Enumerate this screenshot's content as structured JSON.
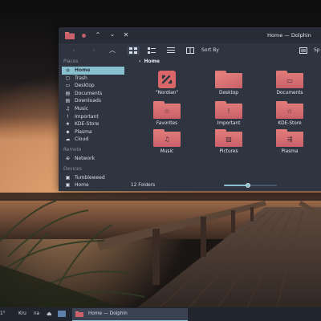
{
  "window": {
    "title": "Home — Dolphin",
    "titlebar_buttons": [
      "chevron-up",
      "chevron-down",
      "close"
    ]
  },
  "toolbar": {
    "back_icon": "arrow-left-icon",
    "forward_icon": "arrow-right-icon",
    "up_icon": "arrow-up-icon",
    "sort_label": "Sort By",
    "search_label": "Sp"
  },
  "sidebar": {
    "places_heading": "Places",
    "places": [
      {
        "label": "Home",
        "icon": "home-icon",
        "active": true
      },
      {
        "label": "Trash",
        "icon": "trash-icon"
      },
      {
        "label": "Desktop",
        "icon": "desktop-icon"
      },
      {
        "label": "Documents",
        "icon": "documents-icon"
      },
      {
        "label": "Downloads",
        "icon": "downloads-icon"
      },
      {
        "label": "Music",
        "icon": "music-icon"
      },
      {
        "label": "Important",
        "icon": "important-icon"
      },
      {
        "label": "KDE-Store",
        "icon": "kde-store-icon"
      },
      {
        "label": "Plasma",
        "icon": "plasma-icon"
      },
      {
        "label": "Cloud",
        "icon": "cloud-icon"
      }
    ],
    "remote_heading": "Remote",
    "remote": [
      {
        "label": "Network",
        "icon": "network-icon"
      }
    ],
    "devices_heading": "Devices",
    "devices": [
      {
        "label": "Tumbleweed",
        "icon": "drive-icon"
      },
      {
        "label": "Home",
        "icon": "drive-icon"
      }
    ]
  },
  "breadcrumb": {
    "current": "Home"
  },
  "folders": [
    {
      "label": "\"Nordian\"",
      "glyph": "",
      "kind": "logo"
    },
    {
      "label": "Desktop",
      "glyph": "",
      "kind": "folder"
    },
    {
      "label": "Documents",
      "glyph": "▭",
      "kind": "folder"
    },
    {
      "label": "Favorites",
      "glyph": "☆",
      "kind": "folder"
    },
    {
      "label": "Important",
      "glyph": "!",
      "kind": "folder"
    },
    {
      "label": "KDE-Store",
      "glyph": "☆",
      "kind": "folder"
    },
    {
      "label": "Music",
      "glyph": "♫",
      "kind": "folder"
    },
    {
      "label": "Pictures",
      "glyph": "▨",
      "kind": "folder"
    },
    {
      "label": "Plasma",
      "glyph": "⇶",
      "kind": "folder"
    }
  ],
  "status": {
    "count": "12 Folders",
    "zoom_fraction": 0.45
  },
  "taskbar": {
    "temp_fragment": "1°",
    "left_text_a": "Kru",
    "left_text_b": "na",
    "task_label": "Home — Dolphin"
  },
  "colors": {
    "accent": "#88c0d0",
    "folder_top": "#e07a78",
    "folder_bottom": "#c9606a",
    "logo_bg": "#d9676a"
  }
}
